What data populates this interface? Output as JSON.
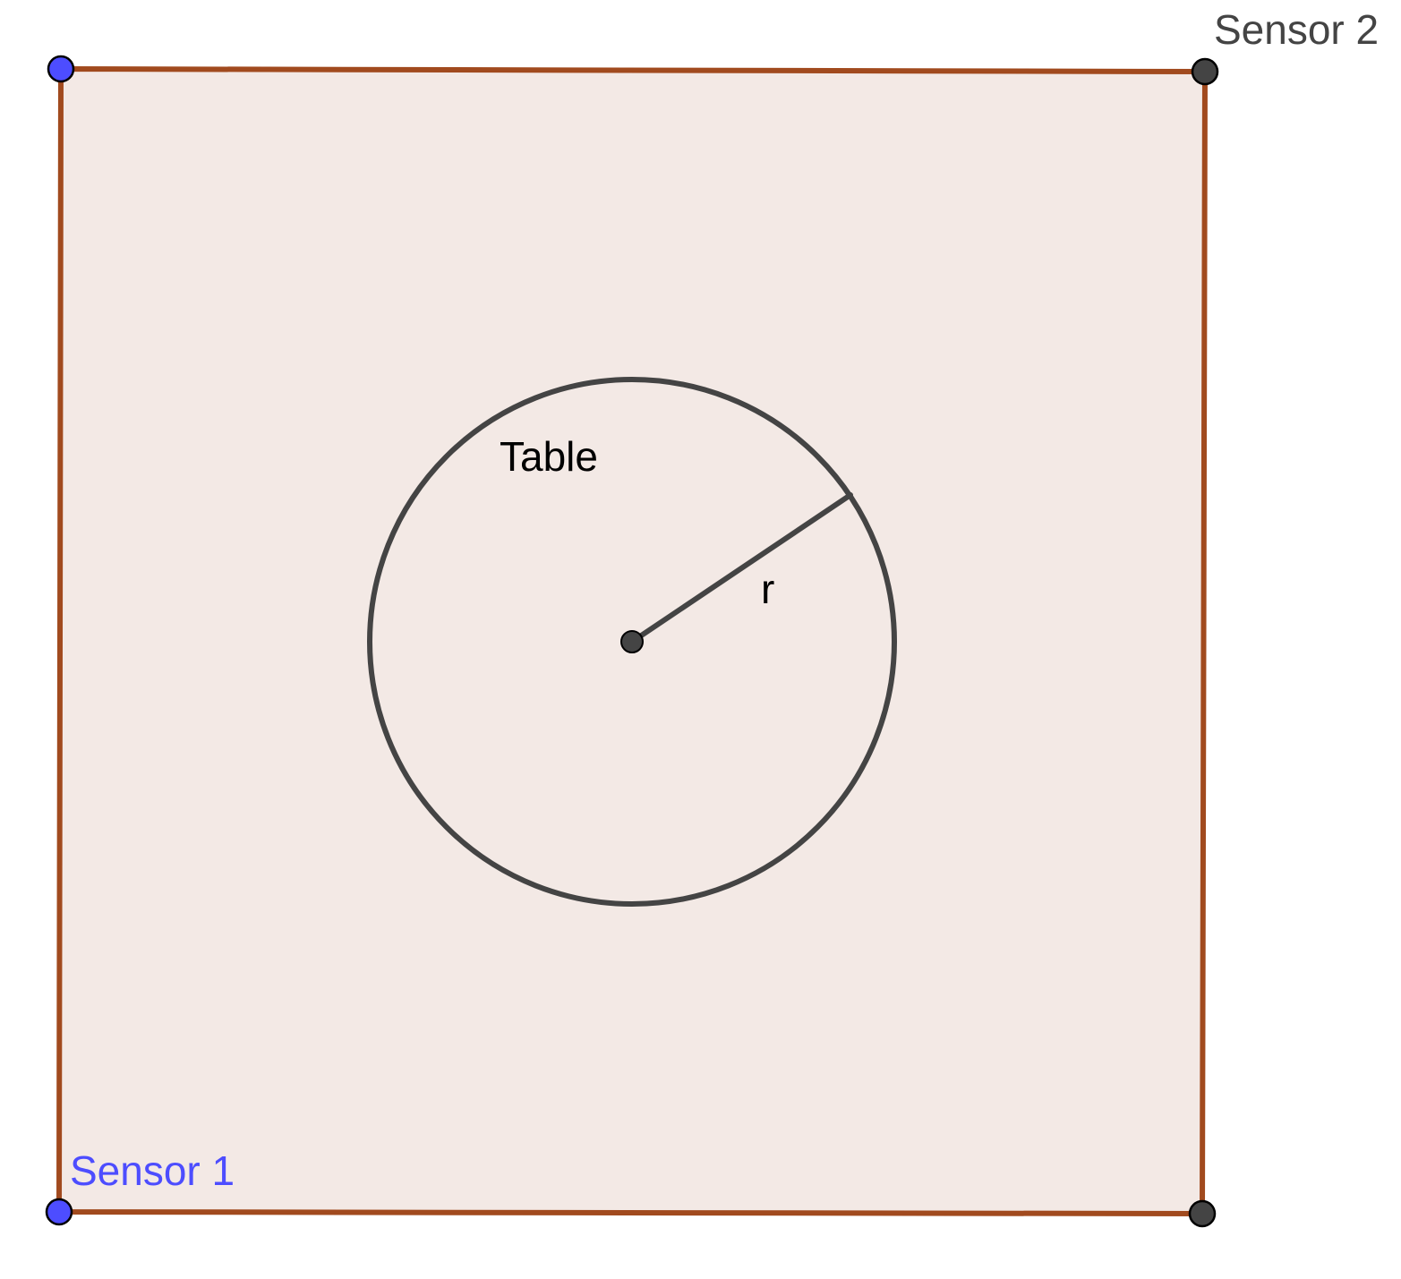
{
  "diagram": {
    "labels": {
      "sensor1": "Sensor 1",
      "sensor2": "Sensor 2",
      "table": "Table",
      "radius": "r"
    },
    "colors": {
      "square_fill": "#f3e9e5",
      "square_stroke": "#a14a1e",
      "circle_stroke": "#444444",
      "radius_stroke": "#444444",
      "point_dark": "#444444",
      "point_blue": "#4d4dff",
      "sensor1_label": "#4d4dff",
      "sensor2_label": "#444444",
      "table_label": "#000000",
      "r_label": "#000000"
    }
  }
}
